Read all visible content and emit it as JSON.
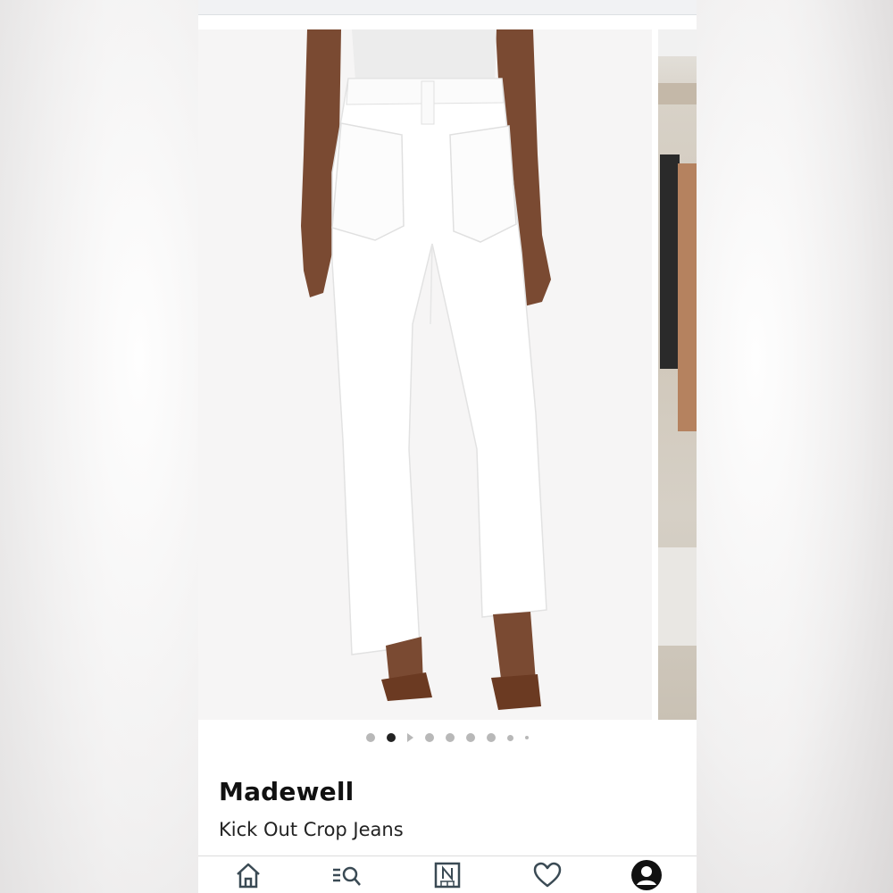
{
  "product": {
    "brand": "Madewell",
    "name": "Kick Out Crop Jeans"
  },
  "gallery": {
    "image_count": 8,
    "active_index": 1,
    "main_image": "white-cropped-jeans-back-view",
    "next_image": "clothing-rack-photo"
  },
  "tabbar": {
    "items": [
      {
        "icon": "home-icon"
      },
      {
        "icon": "search-list-icon"
      },
      {
        "icon": "nordstrom-n-icon"
      },
      {
        "icon": "heart-icon"
      },
      {
        "icon": "account-icon"
      }
    ]
  },
  "colors": {
    "accent": "#222222",
    "inactive_dot": "#b8b8b8"
  }
}
